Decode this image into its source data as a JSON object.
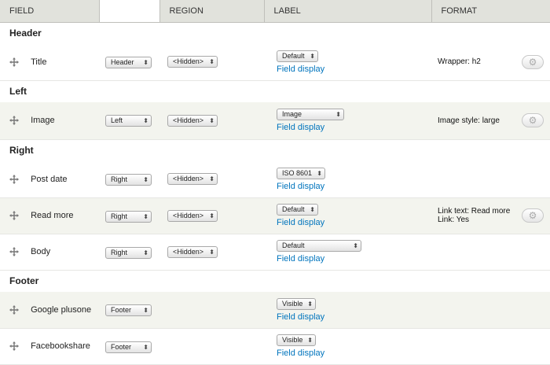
{
  "columns": {
    "field": "FIELD",
    "blank": "",
    "region": "REGION",
    "label": "LABEL",
    "format": "FORMAT"
  },
  "regions": {
    "header": "Header",
    "left": "Left",
    "right": "Right",
    "footer": "Footer"
  },
  "rows": {
    "title": {
      "name": "Title",
      "parent": "Header",
      "label": "<Hidden>",
      "formatter": "Default",
      "link": "Field display",
      "summary": [
        "Wrapper: h2"
      ]
    },
    "image": {
      "name": "Image",
      "parent": "Left",
      "label": "<Hidden>",
      "formatter": "Image",
      "link": "Field display",
      "summary": [
        "Image style: large"
      ]
    },
    "post_date": {
      "name": "Post date",
      "parent": "Right",
      "label": "<Hidden>",
      "formatter": "ISO 8601",
      "link": "Field display",
      "summary": []
    },
    "read_more": {
      "name": "Read more",
      "parent": "Right",
      "label": "<Hidden>",
      "formatter": "Default",
      "link": "Field display",
      "summary": [
        "Link text: Read more",
        "Link: Yes"
      ]
    },
    "body": {
      "name": "Body",
      "parent": "Right",
      "label": "<Hidden>",
      "formatter": "Default",
      "link": "Field display",
      "summary": []
    },
    "google_plusone": {
      "name": "Google plusone",
      "parent": "Footer",
      "formatter": "Visible",
      "link": "Field display",
      "summary": []
    },
    "facebookshare": {
      "name": "Facebookshare",
      "parent": "Footer",
      "formatter": "Visible",
      "link": "Field display",
      "summary": []
    }
  },
  "icons": {
    "drag": "move-cross-icon",
    "settings": "gear-icon",
    "dropdown": "chevron-updown-icon"
  },
  "colors": {
    "header_bg": "#e1e2dc",
    "stripe_bg": "#f3f4ee",
    "link": "#0074bd"
  }
}
